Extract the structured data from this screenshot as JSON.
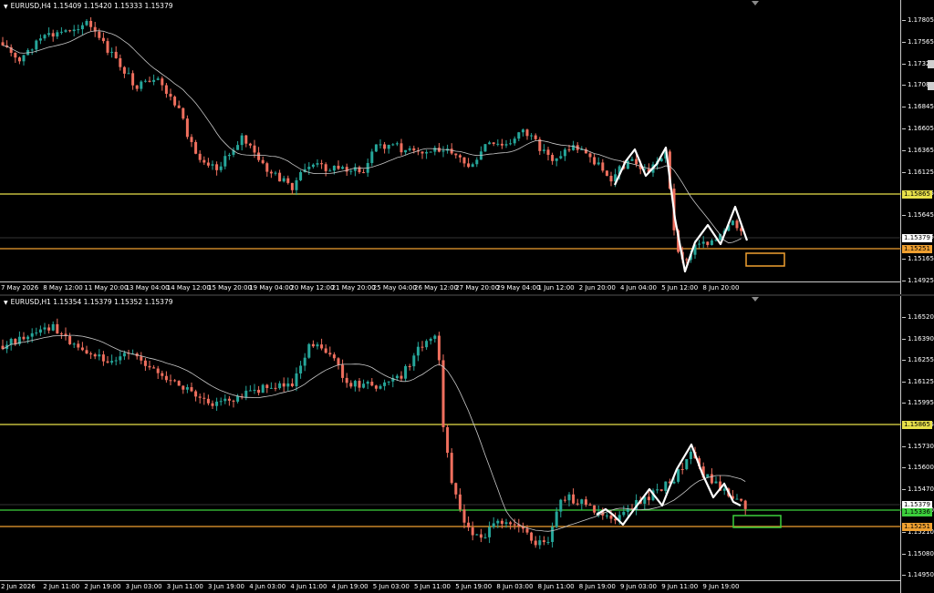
{
  "top_chart": {
    "symbol_label": "EURUSD,H4",
    "ohlc": "1.15409 1.15420 1.15333 1.15379",
    "y_labels": [
      "1.17805",
      "1.17565",
      "1.17325",
      "1.17085",
      "1.16845",
      "1.16605",
      "1.16365",
      "1.16125",
      "1.15885",
      "1.15645",
      "1.15405",
      "1.15165",
      "1.14925"
    ],
    "current_price_badge": "1.15379",
    "level_yellow_badge": "1.15865",
    "level_orange_badge": "1.15251",
    "x_labels": [
      "7 May 2026",
      "8 May 12:00",
      "11 May 20:00",
      "13 May 04:00",
      "14 May 12:00",
      "15 May 20:00",
      "19 May 04:00",
      "20 May 12:00",
      "21 May 20:00",
      "25 May 04:00",
      "26 May 12:00",
      "27 May 20:00",
      "29 May 04:00",
      "1 Jun 12:00",
      "2 Jun 20:00",
      "4 Jun 04:00",
      "5 Jun 12:00",
      "8 Jun 20:00"
    ]
  },
  "bottom_chart": {
    "symbol_label": "EURUSD,H1",
    "ohlc": "1.15354 1.15379 1.15352 1.15379",
    "y_labels": [
      "1.16520",
      "1.16390",
      "1.16255",
      "1.16125",
      "1.15995",
      "1.15865",
      "1.15730",
      "1.15600",
      "1.15470",
      "1.15340",
      "1.15210",
      "1.15080",
      "1.14950"
    ],
    "current_price_badge": "1.15379",
    "level_green_badge": "1.15336",
    "level_yellow_badge": "1.15865",
    "level_orange_badge": "1.15251",
    "x_labels": [
      "2 Jun 2026",
      "2 Jun 11:00",
      "2 Jun 19:00",
      "3 Jun 03:00",
      "3 Jun 11:00",
      "3 Jun 19:00",
      "4 Jun 03:00",
      "4 Jun 11:00",
      "4 Jun 19:00",
      "5 Jun 03:00",
      "5 Jun 11:00",
      "5 Jun 19:00",
      "8 Jun 03:00",
      "8 Jun 11:00",
      "8 Jun 19:00",
      "9 Jun 03:00",
      "9 Jun 11:00",
      "9 Jun 19:00"
    ]
  },
  "colors": {
    "bull_candle": "#26a69a",
    "bear_candle": "#ef6f5e",
    "level_yellow": "#e8e04a",
    "level_orange": "#f0a030",
    "level_green": "#3ccf3c",
    "moving_average": "#c8c8c8",
    "pattern_line": "#ffffff"
  },
  "icons": {
    "symbol_menu": "triangle-down-icon",
    "chart_shift": "chart-shift-icon"
  }
}
